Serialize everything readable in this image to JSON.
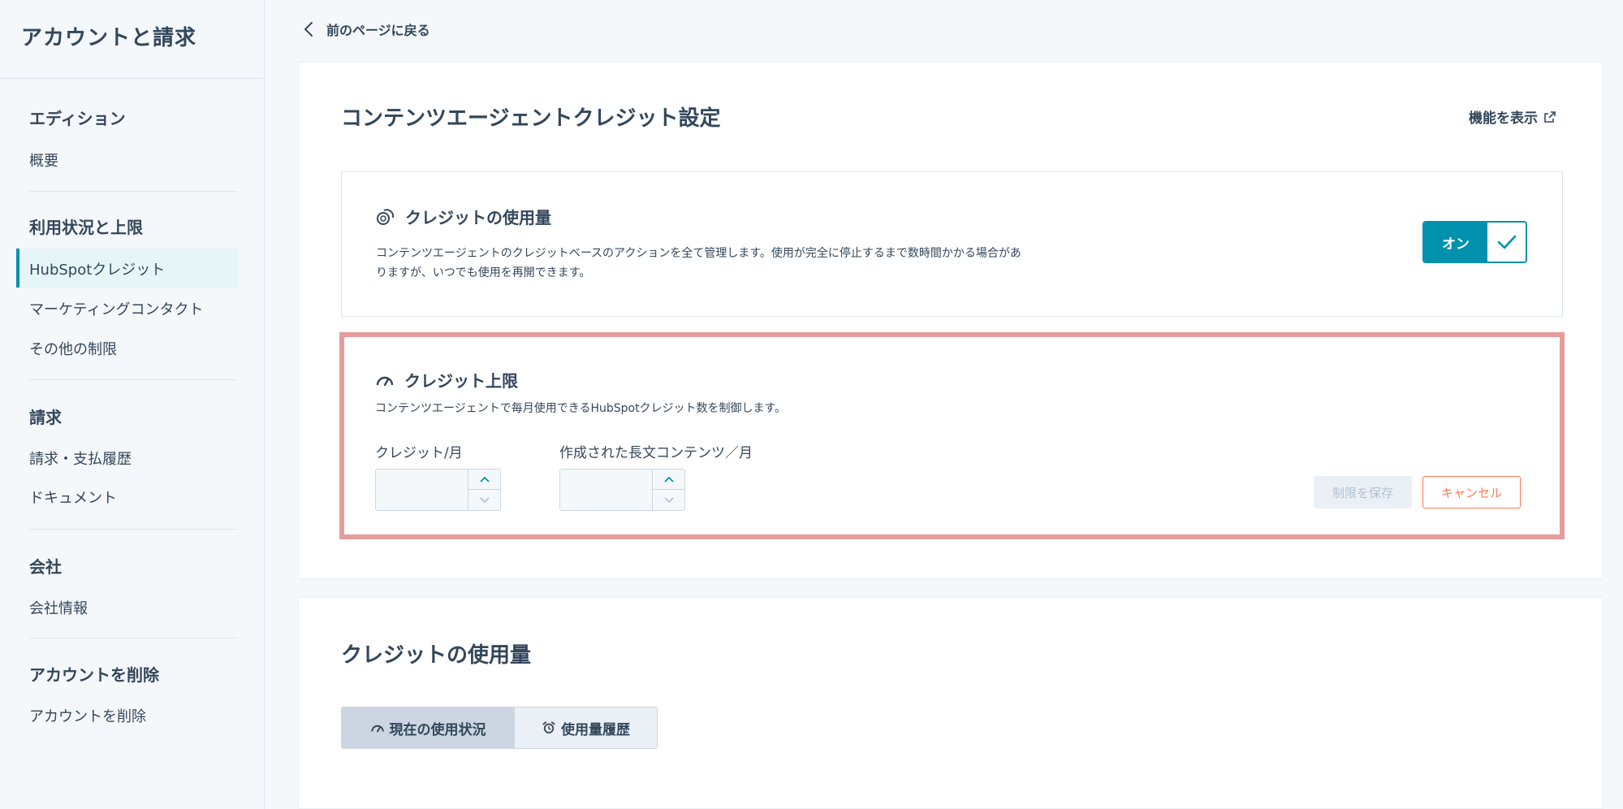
{
  "sidebar": {
    "title": "アカウントと請求",
    "sections": [
      {
        "heading": "エディション",
        "items": [
          "概要"
        ]
      },
      {
        "heading": "利用状況と上限",
        "items": [
          "HubSpotクレジット",
          "マーケティングコンタクト",
          "その他の制限"
        ]
      },
      {
        "heading": "請求",
        "items": [
          "請求・支払履歴",
          "ドキュメント"
        ]
      },
      {
        "heading": "会社",
        "items": [
          "会社情報"
        ]
      },
      {
        "heading": "アカウントを削除",
        "items": [
          "アカウントを削除"
        ]
      }
    ],
    "active_item": "HubSpotクレジット"
  },
  "back_link": "前のページに戻る",
  "main": {
    "title": "コンテンツエージェントクレジット設定",
    "feature_link": "機能を表示",
    "usage_card": {
      "heading": "クレジットの使用量",
      "description_line1": "コンテンツエージェントのクレジットベースのアクションを全て管理します。使用が完全に停止するまで数時間かかる場合があ",
      "description_line2": "りますが、いつでも使用を再開できます。",
      "toggle_label": "オン",
      "toggle_state": "on"
    },
    "limit_card": {
      "heading": "クレジット上限",
      "description": "コンテンツエージェントで毎月使用できるHubSpotクレジット数を制御します。",
      "field1_label": "クレジット/月",
      "field1_value": "",
      "field2_label": "作成された長文コンテンツ／月",
      "field2_value": "",
      "save_button": "制限を保存",
      "cancel_button": "キャンセル"
    }
  },
  "usage_section": {
    "title": "クレジットの使用量",
    "tabs": [
      {
        "label": "現在の使用状況",
        "icon": "gauge-icon",
        "selected": true
      },
      {
        "label": "使用量履歴",
        "icon": "alarm-clock-icon",
        "selected": false
      }
    ]
  },
  "colors": {
    "accent": "#0091ae",
    "highlight_border": "#e79c9c",
    "cancel": "#ff7a59",
    "text": "#33475b"
  }
}
